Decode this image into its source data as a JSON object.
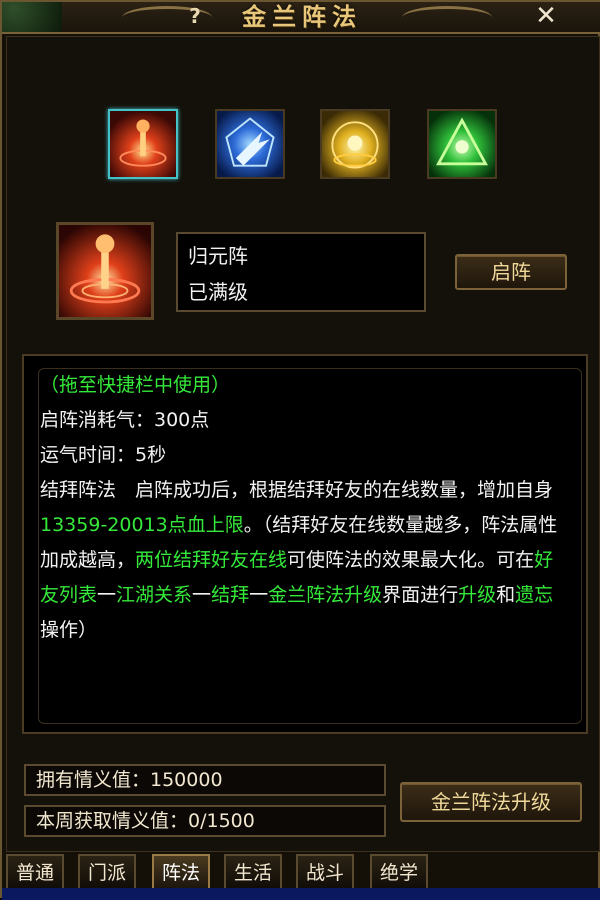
{
  "window": {
    "title": "金兰阵法",
    "help_label": "?",
    "close_label": "✕"
  },
  "formations": [
    {
      "icon": "red-fire-formation-icon",
      "color": "#d8401a",
      "selected": true
    },
    {
      "icon": "blue-lightning-formation-icon",
      "color": "#2d6bd8"
    },
    {
      "icon": "gold-sun-formation-icon",
      "color": "#e0b020"
    },
    {
      "icon": "green-triangle-formation-icon",
      "color": "#2fbf3a"
    }
  ],
  "selected": {
    "name": "归元阵",
    "status": "已满级",
    "start_button": "启阵"
  },
  "description": {
    "line1": "（拖至快捷栏中使用）",
    "line2": "启阵消耗气：300点",
    "line3": "运气时间：5秒",
    "p1": "结拜阵法　启阵成功后，根据结拜好友的在线数量，增加自身",
    "p1_green": "13359-20013点血上限",
    "p2": "。（结拜好友在线数量越多，阵法属性加成越高",
    "p3_pre": "，",
    "p3_green": "两位结拜好友在线",
    "p3_post": "可使阵法的效果最大化",
    "p4_pre": "。可在",
    "p4_g1": "好友列表",
    "p4_dash1": "一",
    "p4_g2": "江湖关系",
    "p4_dash2": "一",
    "p4_g3": "结拜",
    "p4_dash3": "一",
    "p4_g4": "金兰阵法升级",
    "p4_mid": "界面进行",
    "p4_g5": "升级",
    "p4_and": "和",
    "p4_g6": "遗忘",
    "p4_end": "操作）"
  },
  "stats": {
    "owned": "拥有情义值：150000",
    "weekly": "本周获取情义值：0/1500"
  },
  "upgrade_button": "金兰阵法升级",
  "tabs": [
    {
      "label": "普通",
      "active": false
    },
    {
      "label": "门派",
      "active": false
    },
    {
      "label": "阵法",
      "active": true
    },
    {
      "label": "生活",
      "active": false
    },
    {
      "label": "战斗",
      "active": false
    },
    {
      "label": "绝学",
      "active": false
    }
  ],
  "colors": {
    "highlight_green": "#35e93a",
    "title_gold": "#e8c77a",
    "select_cyan": "#45c2c8"
  }
}
